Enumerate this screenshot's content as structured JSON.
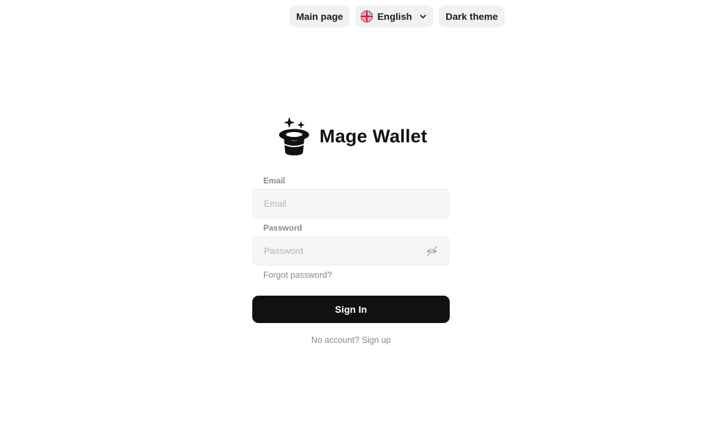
{
  "nav": {
    "main_page": "Main page",
    "language": "English",
    "theme": "Dark theme"
  },
  "brand": {
    "name": "Mage Wallet",
    "logo_icon": "magic-hat-icon"
  },
  "form": {
    "email_label": "Email",
    "email_placeholder": "Email",
    "password_label": "Password",
    "password_placeholder": "Password",
    "forgot": "Forgot password?",
    "signin": "Sign In",
    "signup": "No account? Sign up"
  },
  "colors": {
    "primary_button": "#111111",
    "pill_bg": "#f1f1f1",
    "field_bg": "#f6f6f6",
    "muted_text": "#8a8a8a"
  }
}
